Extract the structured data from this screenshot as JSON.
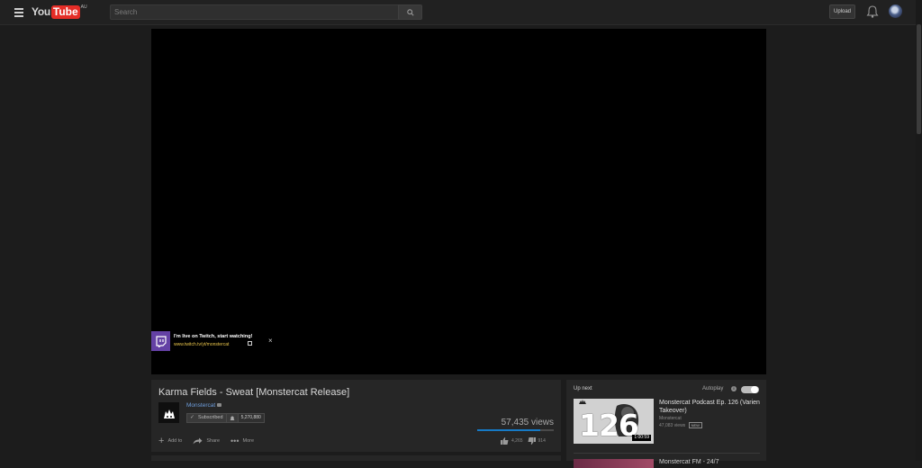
{
  "header": {
    "logo_you": "You",
    "logo_tube": "Tube",
    "logo_region": "AU",
    "search_placeholder": "Search",
    "upload_label": "Upload"
  },
  "annotation_card": {
    "title": "I'm live on Twitch, start watching!",
    "link": "www.twitch.tv/yt/monstercat",
    "close": "×"
  },
  "video": {
    "title": "Karma Fields - Sweat [Monstercat Release]",
    "channel": "Monstercat",
    "subscribe_label": "Subscribed",
    "subscriber_count": "5,270,880",
    "views": "57,435 views",
    "likes": "4,265",
    "dislikes": "914",
    "like_ratio": 0.82,
    "actions": {
      "add_to": "Add to",
      "share": "Share",
      "more": "More"
    }
  },
  "sidebar": {
    "up_next_label": "Up next",
    "autoplay_label": "Autoplay",
    "info_glyph": "i",
    "autoplay_on": true,
    "recommendations": [
      {
        "title": "Monstercat Podcast Ep. 126 (Varien Takeover)",
        "channel": "Monstercat",
        "views": "47,083 views",
        "badge": "NEW",
        "duration": "1:00:59",
        "thumb_number": "126"
      },
      {
        "title": "Monstercat FM - 24/7"
      }
    ]
  },
  "colors": {
    "accent_blue": "#167ac6",
    "youtube_red": "#e52d27",
    "twitch_purple": "#6441a5",
    "link_yellow": "#e8c44a"
  }
}
